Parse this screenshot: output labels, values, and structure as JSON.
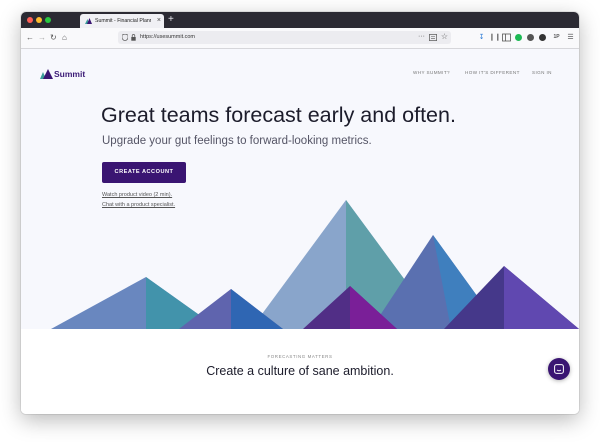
{
  "browser": {
    "tab_title": "Summit - Financial Planning Software",
    "tab_close": "×",
    "new_tab": "+",
    "url": "https://usesummit.com",
    "url_actions": "···"
  },
  "header": {
    "logo_text": "Summit",
    "nav": [
      "WHY SUMMIT?",
      "HOW IT'S DIFFERENT",
      "SIGN IN"
    ]
  },
  "hero": {
    "headline": "Great teams forecast early and often.",
    "subheadline": "Upgrade your gut feelings to forward-looking metrics.",
    "cta_label": "CREATE ACCOUNT",
    "link_video": "Watch product video (2 min).",
    "link_chat": "Chat with a product specialist."
  },
  "section": {
    "eyebrow": "FORECASTING MATTERS",
    "title": "Create a culture of sane ambition."
  },
  "colors": {
    "brand_purple": "#3a1572",
    "page_bg": "#f7f8fd",
    "tab_bar": "#2b2a33"
  },
  "icons": [
    "back-arrow-icon",
    "forward-arrow-icon",
    "reload-icon",
    "home-icon",
    "shield-icon",
    "lock-icon",
    "reader-icon",
    "bookmark-star-icon",
    "download-icon",
    "library-icon",
    "sidebar-icon",
    "extension-icon",
    "menu-icon",
    "chat-bubble-icon"
  ]
}
